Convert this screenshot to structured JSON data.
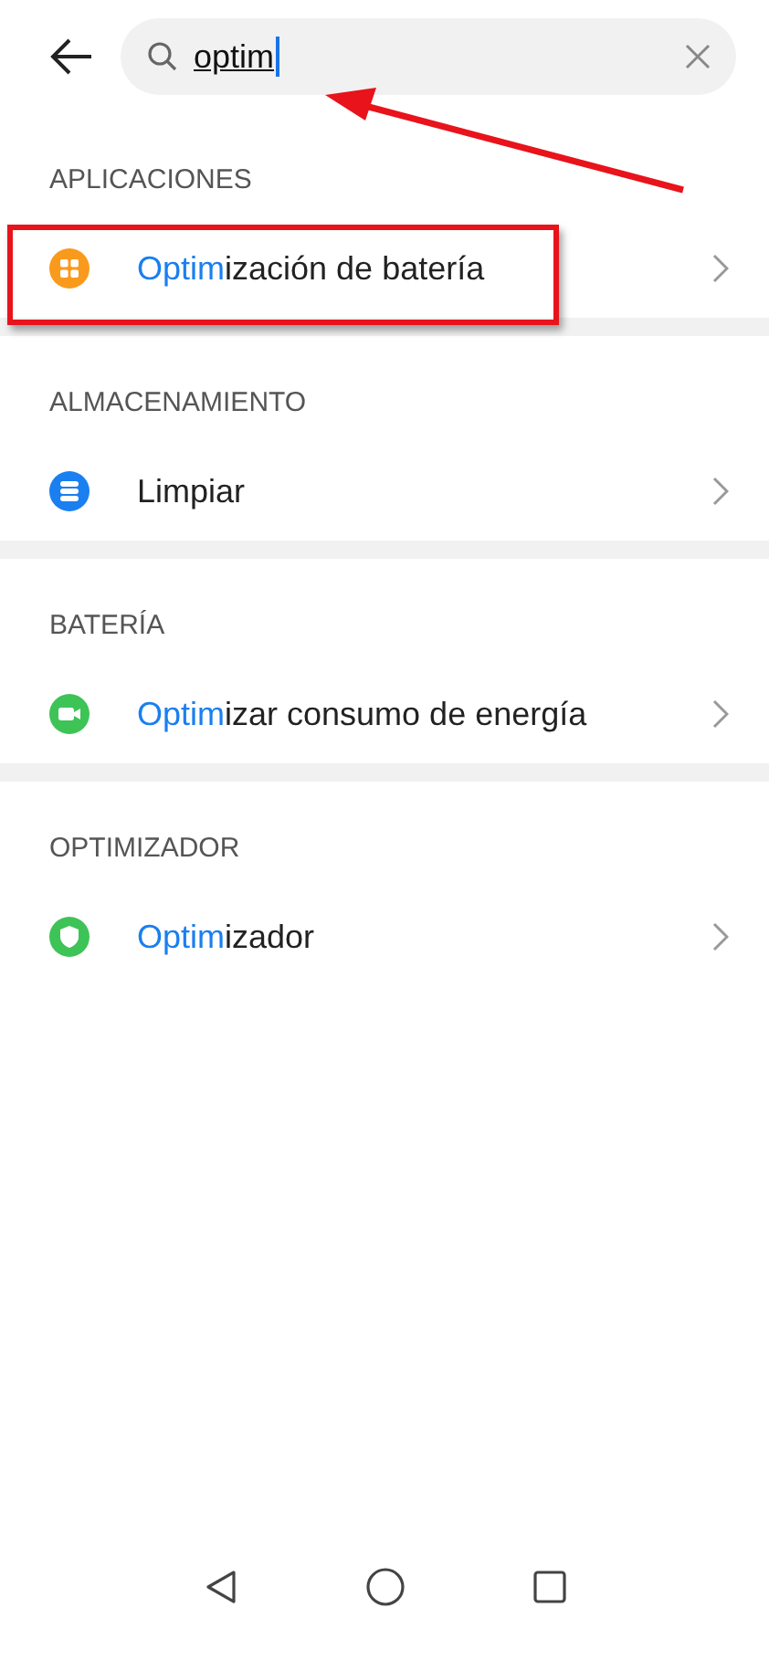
{
  "search": {
    "value": "optim"
  },
  "sections": [
    {
      "header": "APLICACIONES",
      "items": [
        {
          "kind": "apps",
          "match": "Optim",
          "rest": "ización de batería",
          "highlighted": true
        }
      ]
    },
    {
      "header": "ALMACENAMIENTO",
      "items": [
        {
          "kind": "storage",
          "rest": "Limpiar",
          "highlighted": false
        }
      ]
    },
    {
      "header": "BATERÍA",
      "items": [
        {
          "kind": "camera",
          "match": "Optim",
          "rest": "izar consumo de energía",
          "highlighted": false
        }
      ]
    },
    {
      "header": "OPTIMIZADOR",
      "items": [
        {
          "kind": "shield",
          "match": "Optim",
          "rest": "izador",
          "highlighted": false
        }
      ]
    }
  ],
  "annotation": {
    "arrow": true
  }
}
